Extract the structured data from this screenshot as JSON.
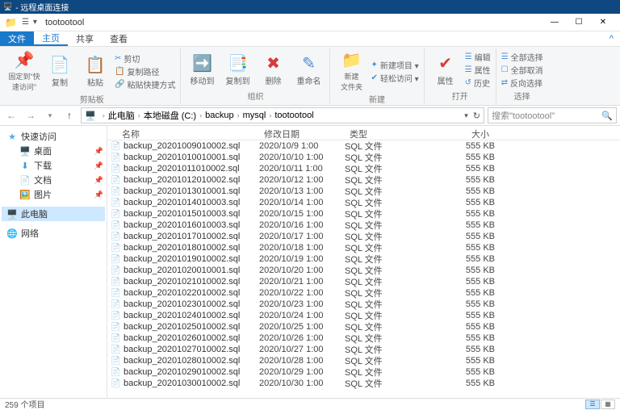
{
  "rdp": {
    "title": "- 远程桌面连接"
  },
  "window": {
    "title": "tootootool",
    "btn_min": "—",
    "btn_max": "☐",
    "btn_close": "✕"
  },
  "ribbon": {
    "tabs": {
      "file": "文件",
      "home": "主页",
      "share": "共享",
      "view": "查看"
    },
    "help": "^",
    "pin": {
      "label": "固定到\"快\n速访问\""
    },
    "copy": {
      "label": "复制"
    },
    "paste": {
      "label": "粘贴"
    },
    "paste_opts": [
      "复制路径",
      "粘贴快捷方式"
    ],
    "cut": "剪切",
    "group_clip": "剪贴板",
    "moveto": "移动到",
    "copyto": "复制到",
    "delete": "删除",
    "rename": "重命名",
    "group_org": "组织",
    "newfolder": "新建\n文件夹",
    "new_opts": [
      "新建项目 ▾",
      "轻松访问 ▾"
    ],
    "group_new": "新建",
    "props": "属性",
    "open_opts": [
      "编辑",
      "属性",
      "历史"
    ],
    "group_open": "打开",
    "select_opts": [
      "全部选择",
      "全部取消",
      "反向选择"
    ],
    "group_select": "选择"
  },
  "addr": {
    "parts": [
      "此电脑",
      "本地磁盘 (C:)",
      "backup",
      "mysql",
      "tootootool"
    ],
    "search_placeholder": "搜索\"tootootool\""
  },
  "nav": {
    "quick": "快速访问",
    "desktop": "桌面",
    "downloads": "下载",
    "documents": "文档",
    "pictures": "图片",
    "thispc": "此电脑",
    "network": "网络"
  },
  "columns": {
    "name": "名称",
    "date": "修改日期",
    "type": "类型",
    "size": "大小"
  },
  "files": [
    {
      "name": "backup_20201009010002.sql",
      "date": "2020/10/9 1:00",
      "type": "SQL 文件",
      "size": "555 KB"
    },
    {
      "name": "backup_20201010010001.sql",
      "date": "2020/10/10 1:00",
      "type": "SQL 文件",
      "size": "555 KB"
    },
    {
      "name": "backup_20201011010002.sql",
      "date": "2020/10/11 1:00",
      "type": "SQL 文件",
      "size": "555 KB"
    },
    {
      "name": "backup_20201012010002.sql",
      "date": "2020/10/12 1:00",
      "type": "SQL 文件",
      "size": "555 KB"
    },
    {
      "name": "backup_20201013010001.sql",
      "date": "2020/10/13 1:00",
      "type": "SQL 文件",
      "size": "555 KB"
    },
    {
      "name": "backup_20201014010003.sql",
      "date": "2020/10/14 1:00",
      "type": "SQL 文件",
      "size": "555 KB"
    },
    {
      "name": "backup_20201015010003.sql",
      "date": "2020/10/15 1:00",
      "type": "SQL 文件",
      "size": "555 KB"
    },
    {
      "name": "backup_20201016010003.sql",
      "date": "2020/10/16 1:00",
      "type": "SQL 文件",
      "size": "555 KB"
    },
    {
      "name": "backup_20201017010002.sql",
      "date": "2020/10/17 1:00",
      "type": "SQL 文件",
      "size": "555 KB"
    },
    {
      "name": "backup_20201018010002.sql",
      "date": "2020/10/18 1:00",
      "type": "SQL 文件",
      "size": "555 KB"
    },
    {
      "name": "backup_20201019010002.sql",
      "date": "2020/10/19 1:00",
      "type": "SQL 文件",
      "size": "555 KB"
    },
    {
      "name": "backup_20201020010001.sql",
      "date": "2020/10/20 1:00",
      "type": "SQL 文件",
      "size": "555 KB"
    },
    {
      "name": "backup_20201021010002.sql",
      "date": "2020/10/21 1:00",
      "type": "SQL 文件",
      "size": "555 KB"
    },
    {
      "name": "backup_20201022010002.sql",
      "date": "2020/10/22 1:00",
      "type": "SQL 文件",
      "size": "555 KB"
    },
    {
      "name": "backup_20201023010002.sql",
      "date": "2020/10/23 1:00",
      "type": "SQL 文件",
      "size": "555 KB"
    },
    {
      "name": "backup_20201024010002.sql",
      "date": "2020/10/24 1:00",
      "type": "SQL 文件",
      "size": "555 KB"
    },
    {
      "name": "backup_20201025010002.sql",
      "date": "2020/10/25 1:00",
      "type": "SQL 文件",
      "size": "555 KB"
    },
    {
      "name": "backup_20201026010002.sql",
      "date": "2020/10/26 1:00",
      "type": "SQL 文件",
      "size": "555 KB"
    },
    {
      "name": "backup_20201027010002.sql",
      "date": "2020/10/27 1:00",
      "type": "SQL 文件",
      "size": "555 KB"
    },
    {
      "name": "backup_20201028010002.sql",
      "date": "2020/10/28 1:00",
      "type": "SQL 文件",
      "size": "555 KB"
    },
    {
      "name": "backup_20201029010002.sql",
      "date": "2020/10/29 1:00",
      "type": "SQL 文件",
      "size": "555 KB"
    },
    {
      "name": "backup_20201030010002.sql",
      "date": "2020/10/30 1:00",
      "type": "SQL 文件",
      "size": "555 KB"
    }
  ],
  "status": {
    "count": "259 个项目"
  }
}
